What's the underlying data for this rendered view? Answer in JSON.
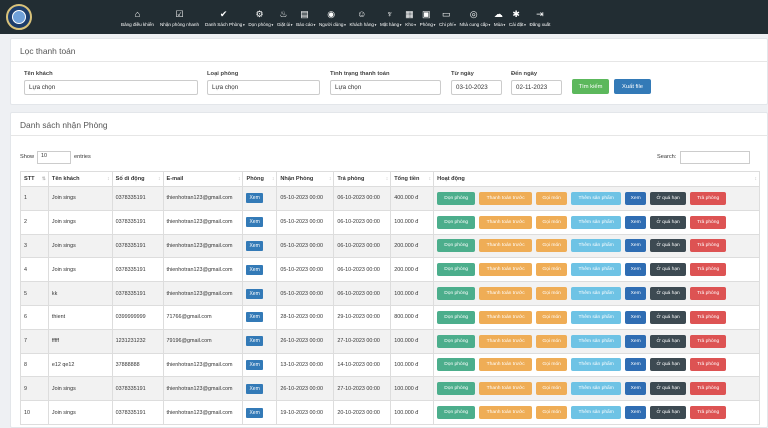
{
  "nav": [
    {
      "icon": "home-icon",
      "glyph": "⌂",
      "label": "Bảng điều khiển",
      "caret": false
    },
    {
      "icon": "check-square-icon",
      "glyph": "☑",
      "label": "Nhận phòng nhanh",
      "caret": false
    },
    {
      "icon": "check-icon",
      "glyph": "✔",
      "label": "Danh Sách Phòng",
      "caret": true
    },
    {
      "icon": "vacuum-icon",
      "glyph": "⚙",
      "label": "Dọn phòng",
      "caret": true
    },
    {
      "icon": "laundry-icon",
      "glyph": "♨",
      "label": "Giặt ủi",
      "caret": true
    },
    {
      "icon": "report-icon",
      "glyph": "▤",
      "label": "Báo cáo",
      "caret": true
    },
    {
      "icon": "user-icon",
      "glyph": "◉",
      "label": "Người dùng",
      "caret": true
    },
    {
      "icon": "customer-icon",
      "glyph": "☺",
      "label": "Khách hàng",
      "caret": true
    },
    {
      "icon": "utensils-icon",
      "glyph": "♆",
      "label": "Mặt hàng",
      "caret": true
    },
    {
      "icon": "warehouse-icon",
      "glyph": "▦",
      "label": "Kho",
      "caret": true
    },
    {
      "icon": "room-icon",
      "glyph": "▣",
      "label": "Phòng",
      "caret": true
    },
    {
      "icon": "money-icon",
      "glyph": "▭",
      "label": "Chi phí",
      "caret": true
    },
    {
      "icon": "supplier-icon",
      "glyph": "◎",
      "label": "Nhà cung cấp",
      "caret": true
    },
    {
      "icon": "cloud-icon",
      "glyph": "☁",
      "label": "Mùa",
      "caret": true
    },
    {
      "icon": "gear-icon",
      "glyph": "✱",
      "label": "Cài đặt",
      "caret": true
    },
    {
      "icon": "logout-icon",
      "glyph": "⇥",
      "label": "Đăng xuất",
      "caret": false
    }
  ],
  "filter": {
    "title": "Lọc thanh toán",
    "customer_label": "Tên khách",
    "customer_value": "Lựa chọn",
    "roomtype_label": "Loại phòng",
    "roomtype_value": "Lựa chọn",
    "status_label": "Tình trạng thanh toán",
    "status_value": "Lựa chọn",
    "from_label": "Từ ngày",
    "from_value": "03-10-2023",
    "to_label": "Đến ngày",
    "to_value": "02-11-2023",
    "search_button": "Tìm kiếm",
    "export_button": "Xuất file"
  },
  "list": {
    "title": "Danh sách nhận Phòng",
    "show_label": "Show",
    "show_value": "10",
    "entries_label": "entries",
    "search_label": "Search:",
    "columns": [
      "STT",
      "Tên khách",
      "Số di động",
      "E-mail",
      "Phòng",
      "Nhận Phòng",
      "Trả phòng",
      "Tổng tiền",
      "Hoạt động"
    ],
    "view_label": "Xem",
    "actions": [
      "Dọn phòng",
      "Thanh toán trước",
      "Gọi món",
      "Thêm sản phẩm",
      "Xem",
      "Ở quá hạn",
      "Trả phòng"
    ],
    "rows": [
      [
        "1",
        "Join sings",
        "0378335191",
        "thienhotran123@gmail.com",
        "05-10-2023 00:00",
        "06-10-2023 00:00",
        "400.000 đ"
      ],
      [
        "2",
        "Join sings",
        "0378335191",
        "thienhotran123@gmail.com",
        "05-10-2023 00:00",
        "06-10-2023 00:00",
        "100.000 đ"
      ],
      [
        "3",
        "Join sings",
        "0378335191",
        "thienhotran123@gmail.com",
        "05-10-2023 00:00",
        "06-10-2023 00:00",
        "200.000 đ"
      ],
      [
        "4",
        "Join sings",
        "0378335191",
        "thienhotran123@gmail.com",
        "05-10-2023 00:00",
        "06-10-2023 00:00",
        "200.000 đ"
      ],
      [
        "5",
        "kk",
        "0378335191",
        "thienhotran123@gmail.com",
        "05-10-2023 00:00",
        "06-10-2023 00:00",
        "100.000 đ"
      ],
      [
        "6",
        "thient",
        "0399999999",
        "71766@gmail.com",
        "28-10-2023 00:00",
        "29-10-2023 00:00",
        "800.000 đ"
      ],
      [
        "7",
        "fffff",
        "1231231232",
        "79196@gmail.com",
        "26-10-2023 00:00",
        "27-10-2023 00:00",
        "100.000 đ"
      ],
      [
        "8",
        "e12 qe12",
        "37888888",
        "thienhotran123@gmail.com",
        "13-10-2023 00:00",
        "14-10-2023 00:00",
        "100.000 đ"
      ],
      [
        "9",
        "Join sings",
        "0378335191",
        "thienhotran123@gmail.com",
        "26-10-2023 00:00",
        "27-10-2023 00:00",
        "100.000 đ"
      ],
      [
        "10",
        "Join sings",
        "0378335191",
        "thienhotran123@gmail.com",
        "19-10-2023 00:00",
        "20-10-2023 00:00",
        "100.000 đ"
      ]
    ]
  }
}
